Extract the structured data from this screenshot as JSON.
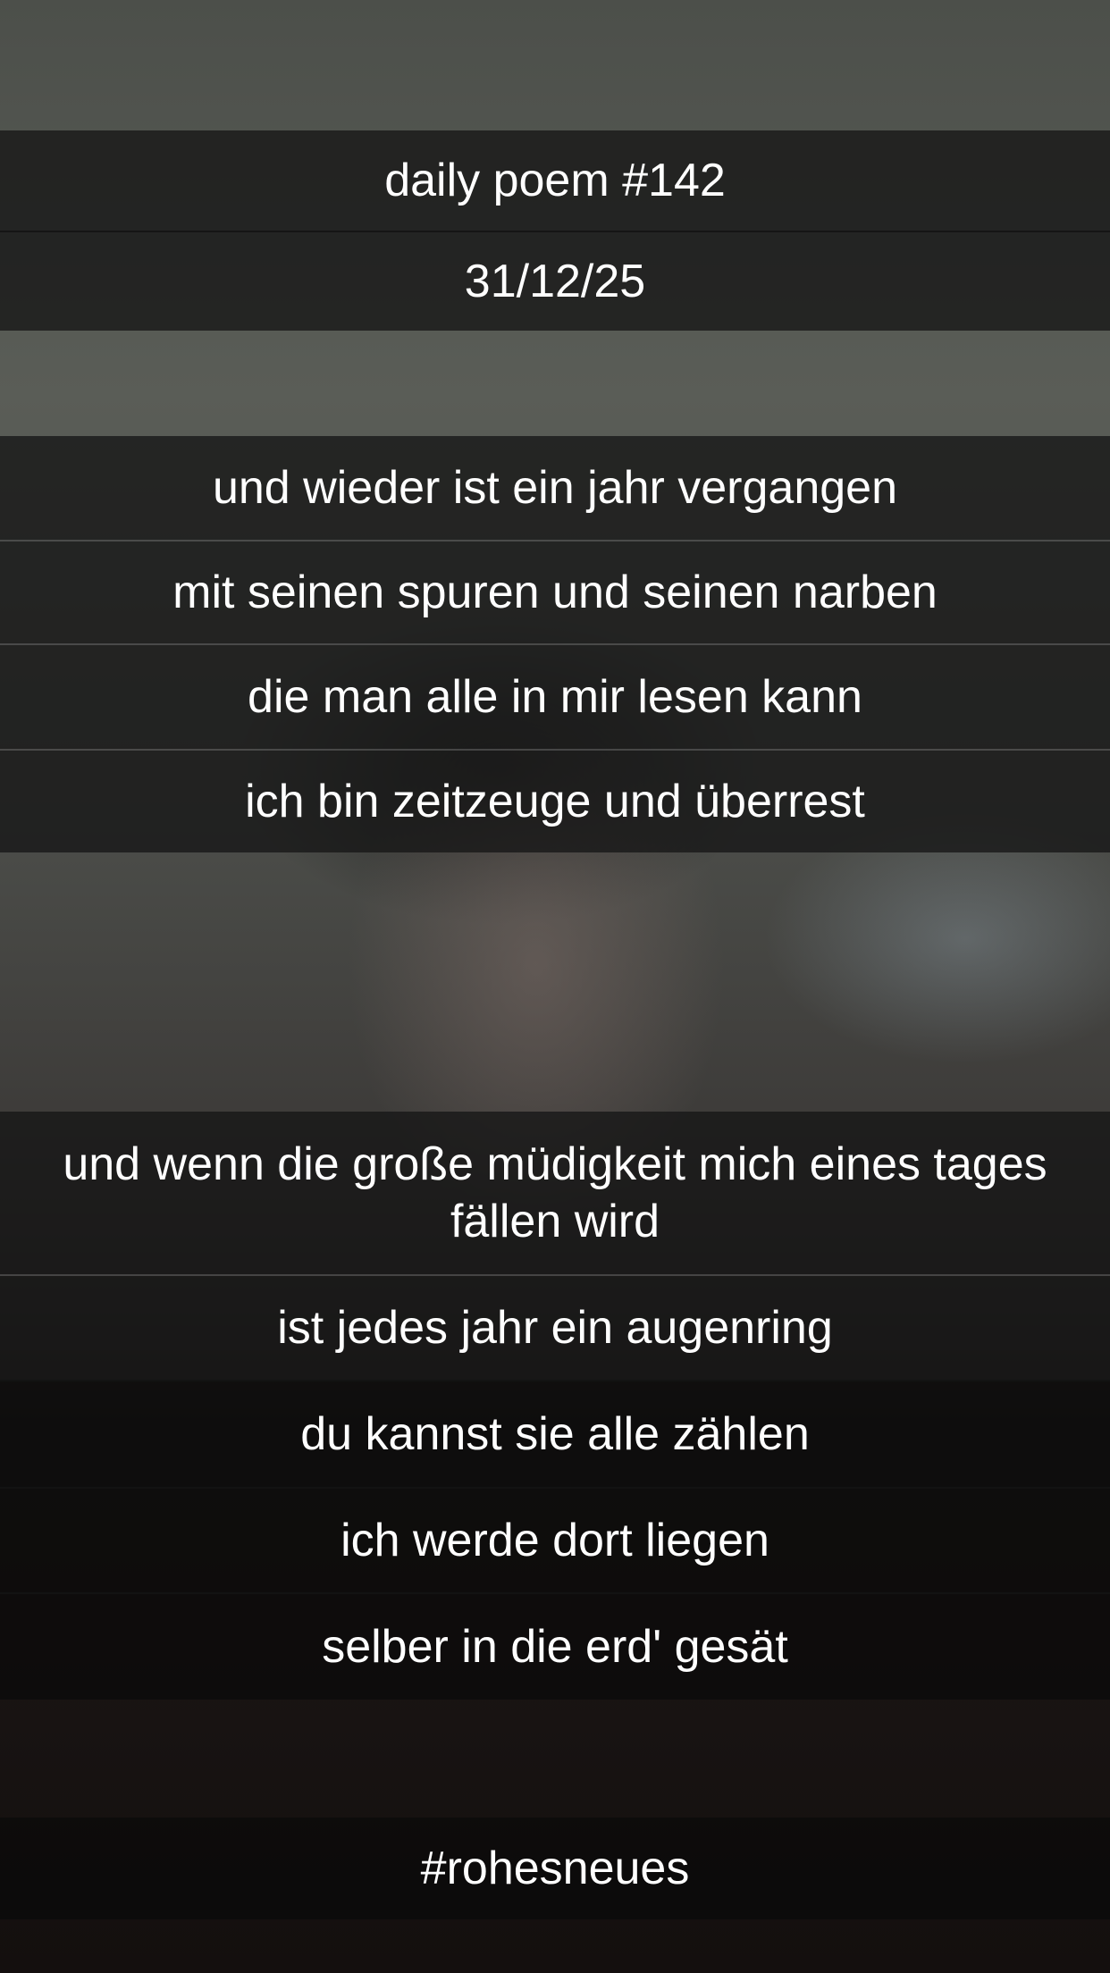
{
  "header": {
    "title": "daily poem #142",
    "date": "31/12/25"
  },
  "stanza1": [
    "und wieder ist ein jahr vergangen",
    "mit seinen spuren und seinen narben",
    "die man alle in mir lesen kann",
    "ich bin zeitzeuge und überrest"
  ],
  "stanza2": [
    "und wenn die große müdigkeit mich eines tages fällen wird",
    "ist jedes jahr ein augenring",
    "du kannst sie alle zählen",
    "ich werde dort liegen",
    "selber in die erd' gesät"
  ],
  "hashtag": "#rohesneues"
}
